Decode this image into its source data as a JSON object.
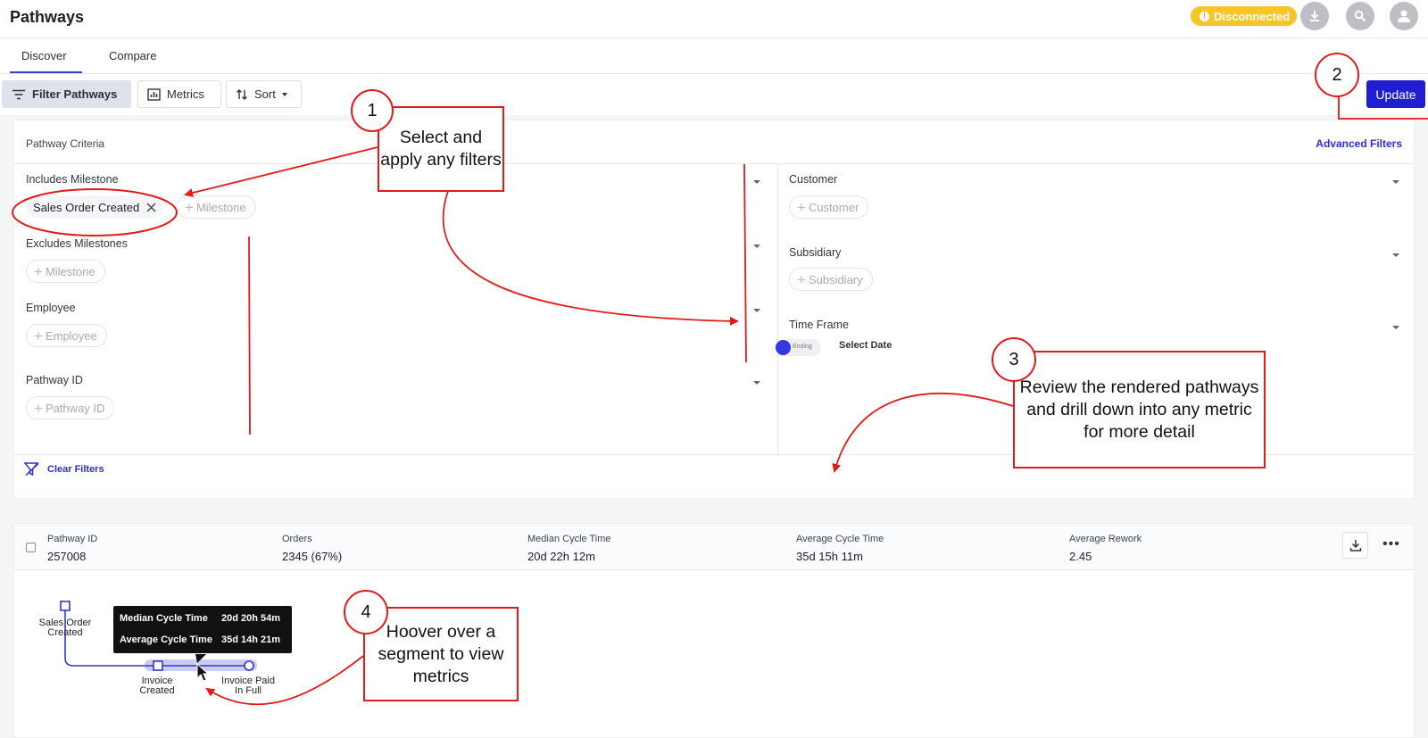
{
  "header": {
    "app_title": "Pathways",
    "status": "Disconnected",
    "status_color": "#f7c526",
    "icons": [
      "download-icon",
      "search-icon",
      "user-icon"
    ]
  },
  "tabs": [
    {
      "label": "Discover",
      "active": true
    },
    {
      "label": "Compare",
      "active": false
    }
  ],
  "toolbar": {
    "filter_label": "Filter Pathways",
    "metrics_label": "Metrics",
    "sort_label": "Sort",
    "update_label": "Update",
    "accent_color": "#1f1fd1"
  },
  "criteria": {
    "title": "Pathway Criteria",
    "advanced_link": "Advanced Filters",
    "includes_label": "Includes Milestone",
    "includes_selected": "Sales Order Created",
    "milestone_chip": "Milestone",
    "excludes_label": "Excludes Milestones",
    "excludes_chip": "Milestone",
    "employee_label": "Employee",
    "employee_chip": "Employee",
    "pathway_id_label": "Pathway ID",
    "pathway_id_chip": "Pathway ID",
    "customer_label": "Customer",
    "customer_chip": "Customer",
    "subsidiary_label": "Subsidiary",
    "subsidiary_chip": "Subsidiary",
    "timeframe_label": "Time Frame",
    "toggle_text": "Ending",
    "select_date": "Select Date",
    "clear_filters": "Clear Filters"
  },
  "results": {
    "columns": [
      {
        "label": "Pathway ID",
        "value": "257008"
      },
      {
        "label": "Orders",
        "value": "2345 (67%)"
      },
      {
        "label": "Median Cycle Time",
        "value": "20d 22h 12m"
      },
      {
        "label": "Average Cycle Time",
        "value": "35d 15h 11m"
      },
      {
        "label": "Average Rework",
        "value": "2.45"
      }
    ],
    "nodes": {
      "start_line1": "Sales Order",
      "start_line2": "Created",
      "mid_line1": "Invoice",
      "mid_line2": "Created",
      "end_line1": "Invoice Paid",
      "end_line2": "In Full"
    },
    "tooltip": {
      "median_label": "Median Cycle Time",
      "median_value": "20d 20h 54m",
      "average_label": "Average Cycle Time",
      "average_value": "35d 14h 21m"
    }
  },
  "callouts": {
    "c1_num": "1",
    "c1_text": "Select and apply any filters",
    "c2_num": "2",
    "c3_num": "3",
    "c3_text": "Review the rendered pathways and drill down into any metric for more detail",
    "c4_num": "4",
    "c4_text": "Hoover over a segment to view metrics",
    "color": "#e31a1a"
  }
}
